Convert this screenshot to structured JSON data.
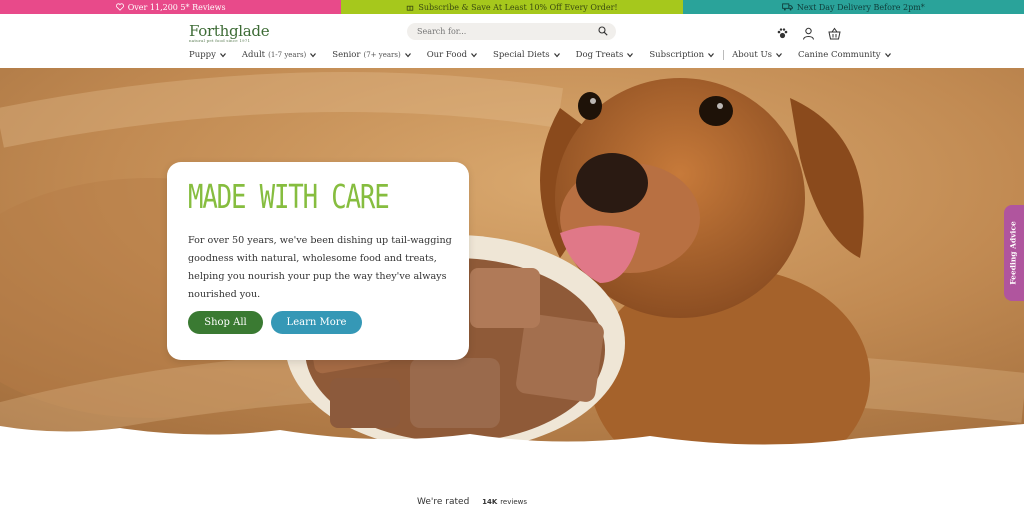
{
  "promo_bar": {
    "reviews": "Over 11,200 5* Reviews",
    "subscribe": "Subscribe & Save At Least 10% Off Every Order!",
    "delivery": "Next Day Delivery Before 2pm*"
  },
  "header": {
    "logo": "Forthglade",
    "logo_tagline": "natural pet food since 1971",
    "search_placeholder": "Search for..."
  },
  "nav": [
    {
      "label": "Puppy",
      "note": ""
    },
    {
      "label": "Adult",
      "note": "(1-7 years)"
    },
    {
      "label": "Senior",
      "note": "(7+ years)"
    },
    {
      "label": "Our Food",
      "note": ""
    },
    {
      "label": "Special Diets",
      "note": ""
    },
    {
      "label": "Dog Treats",
      "note": ""
    },
    {
      "label": "Subscription",
      "note": ""
    },
    {
      "label": "About Us",
      "note": ""
    },
    {
      "label": "Canine Community",
      "note": ""
    }
  ],
  "hero": {
    "heading": "MADE WITH CARE",
    "body": "For over 50 years, we've been dishing up tail-wagging goodness with natural, wholesome food and treats, helping you nourish your pup the way they've always nourished you.",
    "shop_button": "Shop All",
    "learn_button": "Learn More"
  },
  "side_tab": "Feeding Advice",
  "rating": {
    "text": "We're rated",
    "count": "14K",
    "count_suffix": "reviews"
  },
  "colors": {
    "promo_pink": "#e84a8a",
    "promo_green": "#a6c81c",
    "promo_teal": "#2aa39a",
    "brand_green": "#3d6b35",
    "heading_green": "#86bd3f",
    "shop_button": "#3a7a32",
    "learn_button": "#3598b6",
    "feeding_tab": "#b0559e"
  }
}
